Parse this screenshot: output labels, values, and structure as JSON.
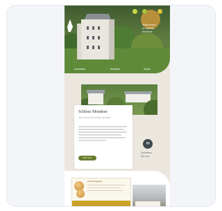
{
  "hero": {
    "tagline": [
      "Willkommen",
      "im Schloss",
      "Mondsee"
    ],
    "captions": [
      "Hochzeiten",
      "Seminare",
      "Urlaub"
    ],
    "dot_colors": [
      "#c7d94a",
      "#a9c23a",
      "#e1c23b"
    ]
  },
  "feature": {
    "title": "Schloss Mondsee",
    "subtitle": "DAS SCHLOSS HOTEL AM SEE",
    "button_label": "Mehr lesen"
  },
  "side": {
    "icon": "✉",
    "text": [
      "Schreiben",
      "Sie uns"
    ]
  },
  "promo": {
    "title": "Unsere Angebote"
  },
  "colors": {
    "beige": "#ece7de",
    "olive": "#6b7d2c",
    "gold": "#c9a227"
  }
}
